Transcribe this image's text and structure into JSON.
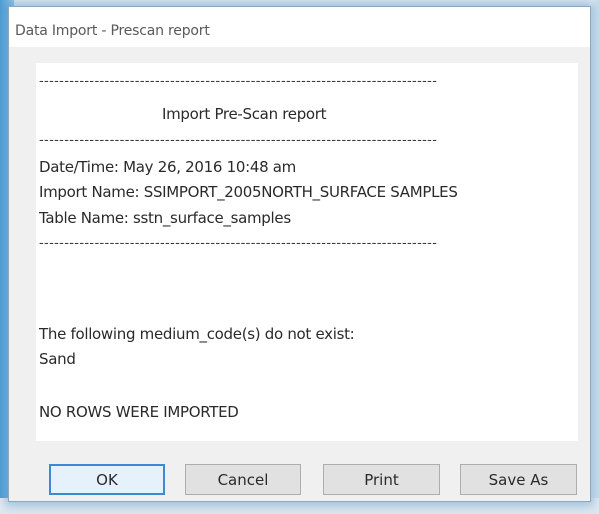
{
  "window": {
    "title": "Data Import - Prescan report"
  },
  "report": {
    "separator": "-------------------------------------------------------------------------------",
    "heading": "Import Pre-Scan report",
    "date_time": "Date/Time:   May 26, 2016  10:48 am",
    "import_name": "Import Name: SSIMPORT_2005NORTH_SURFACE SAMPLES",
    "table_name": "Table Name:  sstn_surface_samples",
    "message": "The following medium_code(s) do not exist:",
    "missing_code": "Sand",
    "result": "NO ROWS WERE IMPORTED"
  },
  "buttons": {
    "ok": "OK",
    "cancel": "Cancel",
    "print": "Print",
    "save_as": "Save As"
  }
}
